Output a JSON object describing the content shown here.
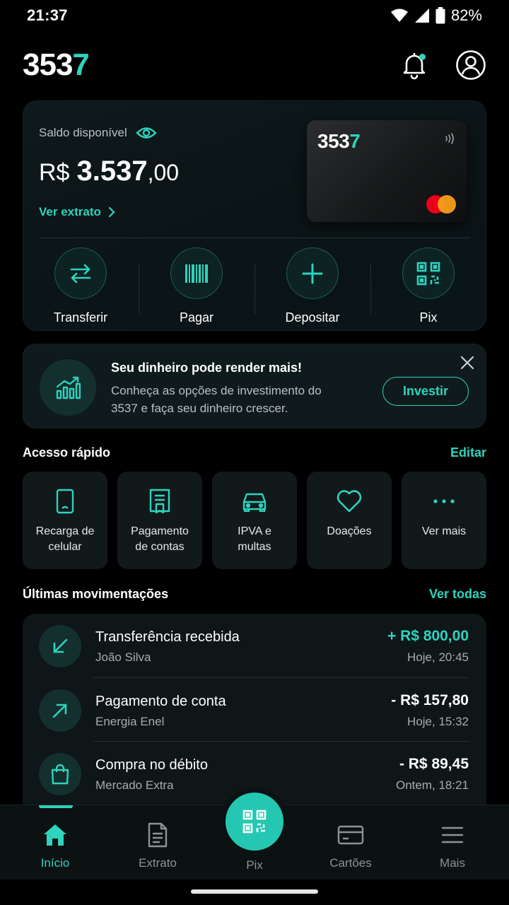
{
  "status_bar": {
    "time": "21:37",
    "battery": "82%"
  },
  "header": {
    "logo_main": "353",
    "logo_accent": "7"
  },
  "balance": {
    "label": "Saldo disponível",
    "currency": "R$",
    "amount_int": "3.537",
    "amount_cents": ",00",
    "statement_link": "Ver extrato"
  },
  "card": {
    "logo_main": "353",
    "logo_accent": "7"
  },
  "actions": [
    {
      "label": "Transferir",
      "icon": "transfer-icon"
    },
    {
      "label": "Pagar",
      "icon": "barcode-icon"
    },
    {
      "label": "Depositar",
      "icon": "plus-icon"
    },
    {
      "label": "Pix",
      "icon": "qr-code-icon"
    }
  ],
  "promo": {
    "title": "Seu dinheiro pode render mais!",
    "description": "Conheça as opções de investimento do 3537 e faça seu dinheiro crescer.",
    "button": "Investir"
  },
  "quick_access": {
    "title": "Acesso rápido",
    "edit": "Editar",
    "items": [
      {
        "label": "Recarga de\ncelular",
        "icon": "phone-icon"
      },
      {
        "label": "Pagamento\nde contas",
        "icon": "receipt-icon"
      },
      {
        "label": "IPVA e\nmultas",
        "icon": "car-icon"
      },
      {
        "label": "Doações",
        "icon": "heart-icon"
      },
      {
        "label": "Ver mais",
        "icon": "more-icon"
      }
    ]
  },
  "transactions": {
    "title": "Últimas movimentações",
    "see_all": "Ver todas",
    "items": [
      {
        "title": "Transferência recebida",
        "subtitle": "João Silva",
        "amount": "+ R$ 800,00",
        "time": "Hoje, 20:45",
        "icon": "arrow-down-left-icon"
      },
      {
        "title": "Pagamento de conta",
        "subtitle": "Energia Enel",
        "amount": "- R$ 157,80",
        "time": "Hoje, 15:32",
        "icon": "arrow-up-right-icon"
      },
      {
        "title": "Compra no débito",
        "subtitle": "Mercado Extra",
        "amount": "- R$ 89,45",
        "time": "Ontem, 18:21",
        "icon": "shopping-bag-icon"
      }
    ]
  },
  "bottom_nav": {
    "items": [
      {
        "label": "Início",
        "icon": "home-icon",
        "active": true
      },
      {
        "label": "Extrato",
        "icon": "document-icon"
      },
      {
        "label": "Pix",
        "icon": "qr-code-icon"
      },
      {
        "label": "Cartões",
        "icon": "credit-card-icon"
      },
      {
        "label": "Mais",
        "icon": "menu-icon"
      }
    ]
  },
  "colors": {
    "accent": "#2ed3bd",
    "background": "#000000",
    "surface": "#0f1a1c",
    "mastercard_red": "#eb001b",
    "mastercard_orange": "#f79e1b"
  }
}
